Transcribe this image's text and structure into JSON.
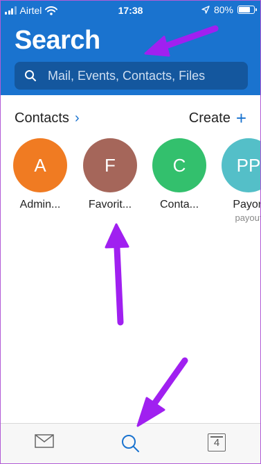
{
  "status_bar": {
    "carrier": "Airtel",
    "time": "17:38",
    "battery_label": "80%",
    "battery_level": 0.8
  },
  "header": {
    "title": "Search"
  },
  "search": {
    "placeholder": "Mail, Events, Contacts, Files"
  },
  "contacts_section": {
    "label": "Contacts",
    "create_label": "Create",
    "items": [
      {
        "initials": "A",
        "name": "Admin...",
        "sub": "",
        "color": "#f07b22"
      },
      {
        "initials": "F",
        "name": "Favorit...",
        "sub": "",
        "color": "#a5665a"
      },
      {
        "initials": "C",
        "name": "Conta...",
        "sub": "",
        "color": "#33c06d"
      },
      {
        "initials": "PP",
        "name": "Payon",
        "sub": "payout",
        "color": "#54bfc8"
      }
    ]
  },
  "tabbar": {
    "calendar_day": "4",
    "active_tab": "search"
  },
  "colors": {
    "header_bg": "#1a73cf",
    "accent": "#1a73cf",
    "annotation_arrow": "#a020f0"
  }
}
